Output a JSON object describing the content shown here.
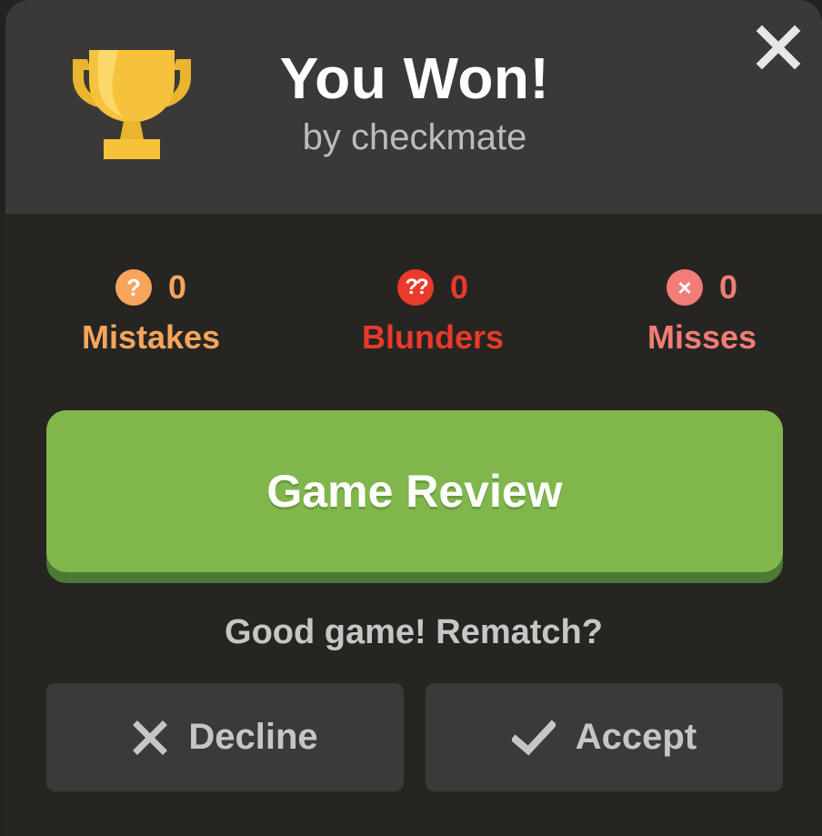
{
  "header": {
    "title": "You Won!",
    "subtitle": "by checkmate"
  },
  "stats": {
    "mistakes": {
      "badge": "?",
      "count": "0",
      "label": "Mistakes",
      "color": "#f7a55c"
    },
    "blunders": {
      "badge": "??",
      "count": "0",
      "label": "Blunders",
      "color": "#ea3a2a"
    },
    "misses": {
      "badge": "×",
      "count": "0",
      "label": "Misses",
      "color": "#f17d76"
    }
  },
  "review": {
    "label": "Game Review",
    "color": "#81b64c"
  },
  "rematch": {
    "prompt": "Good game! Rematch?",
    "decline_label": "Decline",
    "accept_label": "Accept"
  },
  "icons": {
    "trophy": "trophy-icon",
    "close": "close-icon",
    "decline": "x-icon",
    "accept": "checkmark-icon"
  },
  "colors": {
    "header_bg": "#3a3938",
    "body_bg": "#262522",
    "trophy": "#f6c23c"
  }
}
